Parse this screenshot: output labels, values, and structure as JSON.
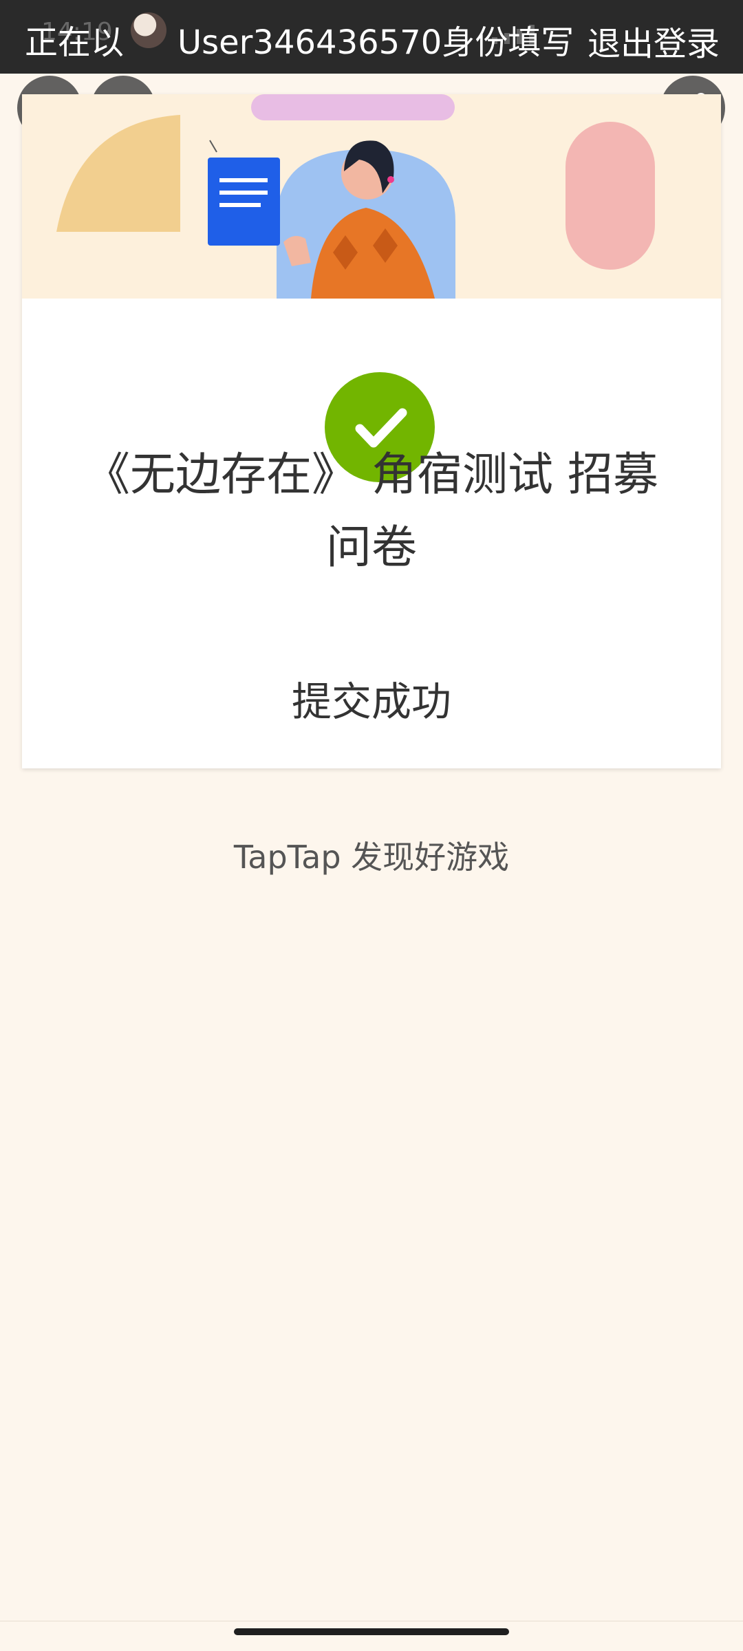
{
  "topbar": {
    "prefix": "正在以",
    "user": "User346436570身份填写",
    "logout": "退出登录"
  },
  "buttons": {
    "back_icon": "chevron-left-icon",
    "close_icon": "close-icon",
    "share_icon": "share-icon"
  },
  "result": {
    "title": "《无边存在》 角宿测试 招募问卷",
    "status": "提交成功"
  },
  "footer": {
    "brand": "TapTap 发现好游戏"
  },
  "colors": {
    "success": "#72b500",
    "background": "#fdf6ed",
    "banner": "#fdf0dc"
  }
}
